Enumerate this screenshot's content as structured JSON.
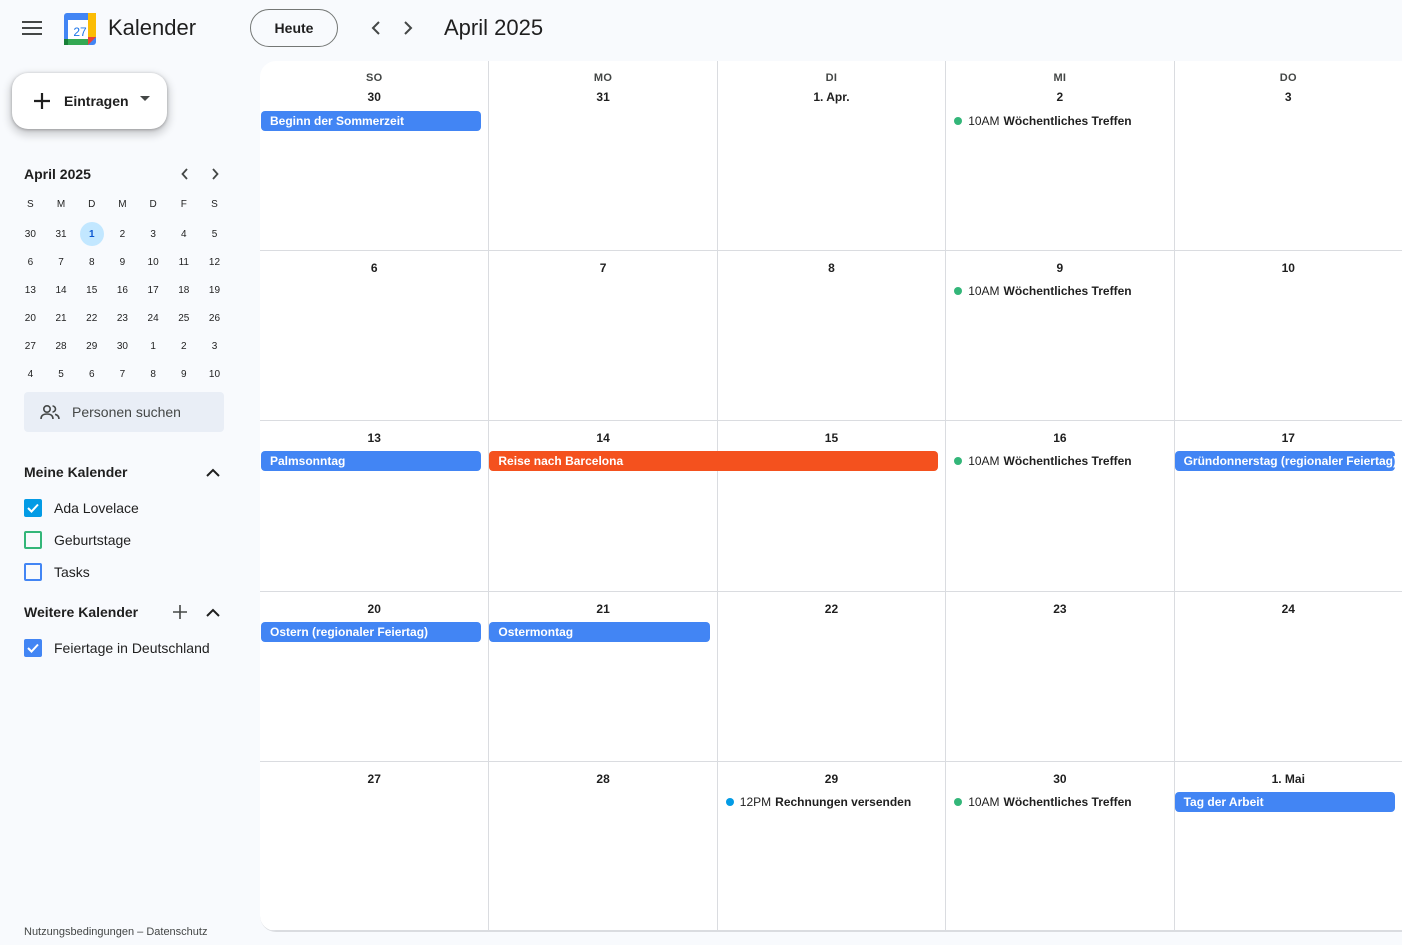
{
  "header": {
    "app_title": "Kalender",
    "logo_day": "27",
    "today_label": "Heute",
    "month_title": "April 2025"
  },
  "sidebar": {
    "create_label": "Eintragen",
    "mini_cal": {
      "title": "April 2025",
      "weekdays": [
        "S",
        "M",
        "D",
        "M",
        "D",
        "F",
        "S"
      ],
      "weeks": [
        [
          "30",
          "31",
          "1",
          "2",
          "3",
          "4",
          "5"
        ],
        [
          "6",
          "7",
          "8",
          "9",
          "10",
          "11",
          "12"
        ],
        [
          "13",
          "14",
          "15",
          "16",
          "17",
          "18",
          "19"
        ],
        [
          "20",
          "21",
          "22",
          "23",
          "24",
          "25",
          "26"
        ],
        [
          "27",
          "28",
          "29",
          "30",
          "1",
          "2",
          "3"
        ],
        [
          "4",
          "5",
          "6",
          "7",
          "8",
          "9",
          "10"
        ]
      ],
      "today": "1"
    },
    "people_search": "Personen suchen",
    "my_calendars": {
      "title": "Meine Kalender",
      "items": [
        {
          "label": "Ada Lovelace",
          "checked": true,
          "color": "#039be5"
        },
        {
          "label": "Geburtstage",
          "checked": false,
          "color": "#33b679"
        },
        {
          "label": "Tasks",
          "checked": false,
          "color": "#4285f4"
        }
      ]
    },
    "other_calendars": {
      "title": "Weitere Kalender",
      "items": [
        {
          "label": "Feiertage in Deutschland",
          "checked": true,
          "color": "#4285f4"
        }
      ]
    },
    "footer": "Nutzungsbedingungen – Datenschutz"
  },
  "grid": {
    "weekdays": [
      "SO",
      "MO",
      "DI",
      "MI",
      "DO"
    ],
    "weeks": [
      {
        "days": [
          "30",
          "31",
          "1. Apr.",
          "2",
          "3"
        ]
      },
      {
        "days": [
          "6",
          "7",
          "8",
          "9",
          "10"
        ]
      },
      {
        "days": [
          "13",
          "14",
          "15",
          "16",
          "17"
        ]
      },
      {
        "days": [
          "20",
          "21",
          "22",
          "23",
          "24"
        ]
      },
      {
        "days": [
          "27",
          "28",
          "29",
          "30",
          "1. Mai"
        ]
      }
    ],
    "events": [
      {
        "week": 0,
        "col": 0,
        "span": 1,
        "type": "chip",
        "title": "Beginn der Sommerzeit",
        "color": "#4285f4"
      },
      {
        "week": 0,
        "col": 3,
        "type": "dot",
        "time": "10AM",
        "title": "Wöchentliches Treffen",
        "color": "#33b679"
      },
      {
        "week": 1,
        "col": 3,
        "type": "dot",
        "time": "10AM",
        "title": "Wöchentliches Treffen",
        "color": "#33b679"
      },
      {
        "week": 2,
        "col": 0,
        "span": 1,
        "type": "chip",
        "title": "Palmsonntag",
        "color": "#4285f4"
      },
      {
        "week": 2,
        "col": 1,
        "span": 2,
        "type": "chip",
        "title": "Reise nach Barcelona",
        "color": "#f4511e"
      },
      {
        "week": 2,
        "col": 3,
        "type": "dot",
        "time": "10AM",
        "title": "Wöchentliches Treffen",
        "color": "#33b679"
      },
      {
        "week": 2,
        "col": 4,
        "span": 1,
        "type": "chip",
        "title": "Gründonnerstag (regionaler Feiertag)",
        "color": "#4285f4"
      },
      {
        "week": 3,
        "col": 0,
        "span": 1,
        "type": "chip",
        "title": "Ostern (regionaler Feiertag)",
        "color": "#4285f4"
      },
      {
        "week": 3,
        "col": 1,
        "span": 1,
        "type": "chip",
        "title": "Ostermontag",
        "color": "#4285f4"
      },
      {
        "week": 4,
        "col": 2,
        "type": "dot",
        "time": "12PM",
        "title": "Rechnungen versenden",
        "color": "#039be5"
      },
      {
        "week": 4,
        "col": 3,
        "type": "dot",
        "time": "10AM",
        "title": "Wöchentliches Treffen",
        "color": "#33b679"
      },
      {
        "week": 4,
        "col": 4,
        "span": 1,
        "type": "chip",
        "title": "Tag der Arbeit",
        "color": "#4285f4"
      }
    ]
  }
}
